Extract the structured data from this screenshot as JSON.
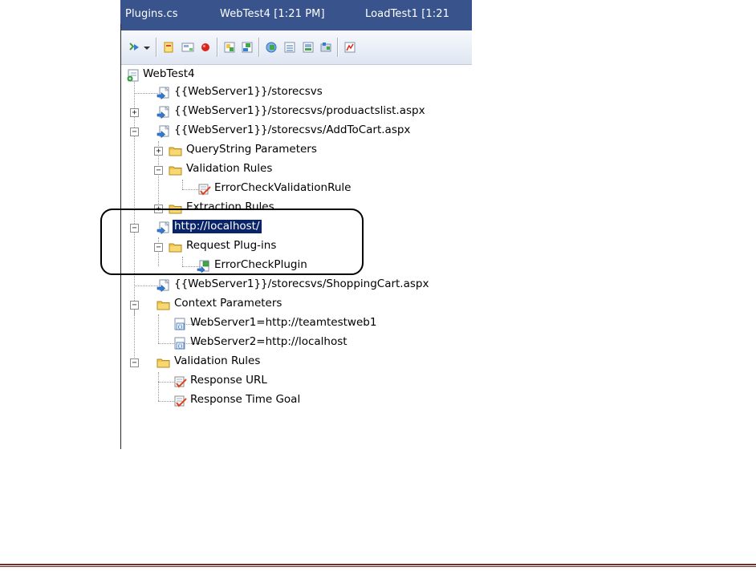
{
  "tabs": [
    {
      "label": "Plugins.cs"
    },
    {
      "label": "WebTest4 [1:21 PM]"
    },
    {
      "label": "LoadTest1 [1:21"
    }
  ],
  "toolbar_icons": [
    "run-test-icon",
    "dropdown-arrow-icon",
    "add-request-icon",
    "insert-comment-icon",
    "record-icon",
    "add-transaction-icon",
    "add-plugin-icon",
    "parameterize-icon",
    "add-datasource-icon",
    "add-context-param-icon",
    "set-credentials-icon",
    "generate-code-icon"
  ],
  "tree": {
    "root": "WebTest4",
    "items": [
      {
        "label": "{{WebServer1}}/storecsvs"
      },
      {
        "label": "{{WebServer1}}/storecsvs/produactslist.aspx"
      },
      {
        "label": "{{WebServer1}}/storecsvs/AddToCart.aspx"
      },
      {
        "label": "QueryString Parameters"
      },
      {
        "label": "Validation Rules"
      },
      {
        "label": "ErrorCheckValidationRule"
      },
      {
        "label": "Extraction Rules"
      },
      {
        "label": "http://localhost/"
      },
      {
        "label": "Request Plug-ins"
      },
      {
        "label": "ErrorCheckPlugin"
      },
      {
        "label": "{{WebServer1}}/storecsvs/ShoppingCart.aspx"
      },
      {
        "label": "Context Parameters"
      },
      {
        "label": "WebServer1=http://teamtestweb1"
      },
      {
        "label": "WebServer2=http://localhost"
      },
      {
        "label": "Validation Rules"
      },
      {
        "label": "Response URL"
      },
      {
        "label": "Response Time Goal"
      }
    ]
  },
  "colors": {
    "tabbar": "#39548c",
    "selection": "#0a246a",
    "folder": "#f2c44e",
    "footer_rule": "#7b2a22"
  }
}
